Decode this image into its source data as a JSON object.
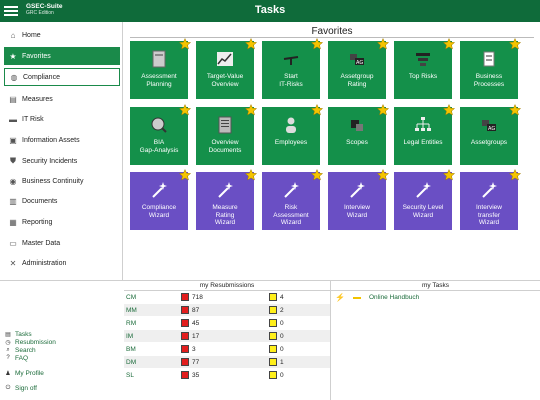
{
  "header": {
    "logo_line1": "GSEC-Suite",
    "logo_line2": "GRC Edition",
    "title": "Tasks"
  },
  "sidebar": {
    "items": [
      {
        "label": "Home",
        "icon": "home-icon"
      },
      {
        "label": "Favorites",
        "icon": "star-icon"
      },
      {
        "label": "Compliance",
        "icon": "compliance-icon"
      },
      {
        "label": "Measures",
        "icon": "measures-icon"
      },
      {
        "label": "IT Risk",
        "icon": "it-risk-icon"
      },
      {
        "label": "Information Assets",
        "icon": "information-assets-icon"
      },
      {
        "label": "Security Incidents",
        "icon": "shield-icon"
      },
      {
        "label": "Business Continuity",
        "icon": "globe-icon"
      },
      {
        "label": "Documents",
        "icon": "documents-icon"
      },
      {
        "label": "Reporting",
        "icon": "reporting-icon"
      },
      {
        "label": "Master Data",
        "icon": "master-data-icon"
      },
      {
        "label": "Administration",
        "icon": "wrench-icon"
      }
    ],
    "bottom_links": [
      {
        "label": "Tasks",
        "icon": "tasks-icon"
      },
      {
        "label": "Resubmission",
        "icon": "clock-icon"
      },
      {
        "label": "Search",
        "icon": "search-icon"
      },
      {
        "label": "FAQ",
        "icon": "question-icon"
      },
      {
        "label": "My Profile",
        "icon": "user-icon"
      },
      {
        "label": "Sign off",
        "icon": "power-icon"
      }
    ]
  },
  "favorites": {
    "title": "Favorites",
    "tiles": [
      {
        "label": "Assessment\nPlanning",
        "color": "green",
        "icon": "assessment-planning-icon"
      },
      {
        "label": "Target-Value\nOverview",
        "color": "green",
        "icon": "chart-icon"
      },
      {
        "label": "Start\nIT-Risks",
        "color": "green",
        "icon": "scale-icon"
      },
      {
        "label": "Assetgroup\nRating",
        "color": "green",
        "icon": "assetgroup-rating-icon"
      },
      {
        "label": "Top Risks",
        "color": "green",
        "icon": "top-risks-icon"
      },
      {
        "label": "Business\nProcesses",
        "color": "green",
        "icon": "business-processes-icon"
      },
      {
        "label": "BIA\nGap-Analysis",
        "color": "green",
        "icon": "bia-icon"
      },
      {
        "label": "Overview\nDocuments",
        "color": "green",
        "icon": "documents-icon"
      },
      {
        "label": "Employees",
        "color": "green",
        "icon": "employee-icon"
      },
      {
        "label": "Scopes",
        "color": "green",
        "icon": "scopes-icon"
      },
      {
        "label": "Legal Entities",
        "color": "green",
        "icon": "org-chart-icon"
      },
      {
        "label": "Assetgroups",
        "color": "green",
        "icon": "assetgroups-icon"
      },
      {
        "label": "Compliance\nWizard",
        "color": "purple",
        "icon": "wand-icon"
      },
      {
        "label": "Measure\nRating\nWizard",
        "color": "purple",
        "icon": "wand-icon"
      },
      {
        "label": "Risk\nAssessment\nWizard",
        "color": "purple",
        "icon": "wand-icon"
      },
      {
        "label": "Interview\nWizard",
        "color": "purple",
        "icon": "wand-icon"
      },
      {
        "label": "Security Level\nWizard",
        "color": "purple",
        "icon": "wand-icon"
      },
      {
        "label": "Interview\ntransfer\nWizard",
        "color": "purple",
        "icon": "wand-icon"
      }
    ]
  },
  "resubmissions": {
    "title": "my Resubmissions",
    "rows": [
      {
        "cat": "CM",
        "red": "718",
        "yellow": "4"
      },
      {
        "cat": "MM",
        "red": "87",
        "yellow": "2"
      },
      {
        "cat": "RM",
        "red": "45",
        "yellow": "0"
      },
      {
        "cat": "IM",
        "red": "17",
        "yellow": "0"
      },
      {
        "cat": "BM",
        "red": "3",
        "yellow": "0"
      },
      {
        "cat": "DM",
        "red": "77",
        "yellow": "1"
      },
      {
        "cat": "SL",
        "red": "35",
        "yellow": "0"
      }
    ]
  },
  "tasks": {
    "title": "my Tasks",
    "items": [
      {
        "label": "Online Handbuch"
      }
    ]
  },
  "colors": {
    "header": "#0f6b3a",
    "tile_green": "#14904a",
    "tile_purple": "#6a4fc4",
    "active_nav": "#1a8a4a",
    "star": "#f5c400"
  }
}
